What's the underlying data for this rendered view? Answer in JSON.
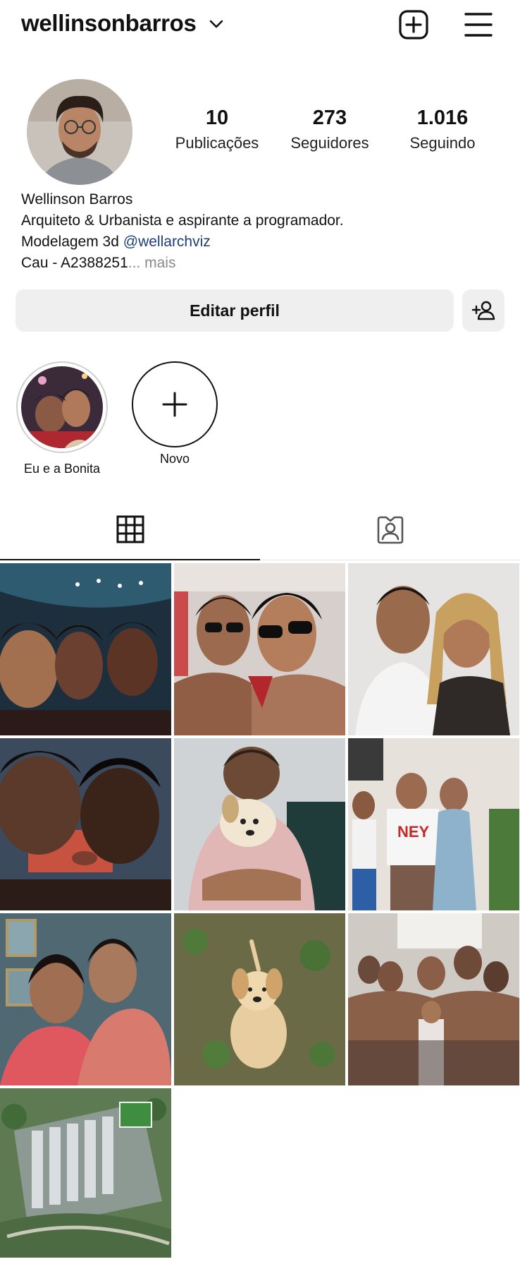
{
  "header": {
    "username": "wellinsonbarros",
    "icons": {
      "dropdown": "chevron-down-icon",
      "new_post": "plus-square-icon",
      "menu": "hamburger-menu-icon"
    }
  },
  "profile": {
    "avatar_icon": "profile-photo",
    "stats": [
      {
        "value": "10",
        "label": "Publicações"
      },
      {
        "value": "273",
        "label": "Seguidores"
      },
      {
        "value": "1.016",
        "label": "Seguindo"
      }
    ],
    "name": "Wellinson Barros",
    "bio_line1": "Arquiteto & Urbanista e aspirante a programador.",
    "bio_line2_prefix": "Modelagem 3d ",
    "bio_mention": "@wellarchviz",
    "bio_line3": "Cau - A2388251",
    "bio_more": "... mais"
  },
  "actions": {
    "edit_profile": "Editar perfil",
    "discover_people_icon": "add-person-icon"
  },
  "highlights": [
    {
      "label": "Eu e a Bonita"
    },
    {
      "label": "Novo"
    }
  ],
  "tabs": {
    "active": "grid",
    "icons": [
      "grid-icon",
      "tagged-person-icon"
    ]
  },
  "colors": {
    "text": "#111111",
    "link": "#1e3e7a",
    "muted": "#8a8a8a",
    "button_bg": "#efefef"
  }
}
